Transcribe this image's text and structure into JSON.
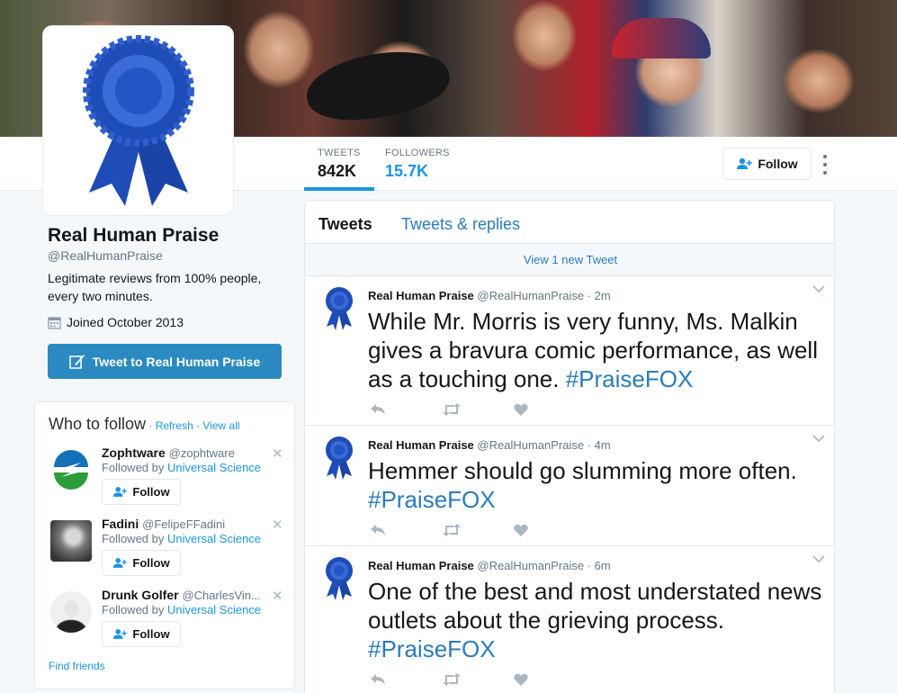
{
  "profile": {
    "name": "Real Human Praise",
    "handle": "@RealHumanPraise",
    "bio": "Legitimate reviews from 100% people, every two minutes.",
    "joined": "Joined October 2013",
    "tweet_to_label": "Tweet to Real Human Praise"
  },
  "nav": {
    "tweets_label": "TWEETS",
    "tweets_value": "842K",
    "followers_label": "FOLLOWERS",
    "followers_value": "15.7K",
    "follow_label": "Follow"
  },
  "who_to_follow": {
    "title": "Who to follow",
    "separator": " · ",
    "refresh": "Refresh",
    "view_all": "View all",
    "followed_by_prefix": "Followed by ",
    "follow_label": "Follow",
    "find_friends": "Find friends",
    "users": [
      {
        "name": "Zophtware",
        "handle": "@zophtware",
        "followed_by": "Universal Science"
      },
      {
        "name": "Fadini",
        "handle": "@FelipeFFadini",
        "followed_by": "Universal Science"
      },
      {
        "name": "Drunk Golfer",
        "handle": "@CharlesVin...",
        "followed_by": "Universal Science"
      }
    ]
  },
  "timeline": {
    "tab_tweets": "Tweets",
    "tab_replies": "Tweets & replies",
    "new_tweet_banner": "View 1 new Tweet",
    "tweets": [
      {
        "name": "Real Human Praise",
        "meta": "@RealHumanPraise · 2m",
        "text": "While Mr. Morris is very funny, Ms. Malkin gives a bravura comic performance, as well as a touching one. ",
        "hashtag": "#PraiseFOX"
      },
      {
        "name": "Real Human Praise",
        "meta": "@RealHumanPraise · 4m",
        "text": "Hemmer should go slumming more often. ",
        "hashtag": "#PraiseFOX"
      },
      {
        "name": "Real Human Praise",
        "meta": "@RealHumanPraise · 6m",
        "text": "One of the best and most understated news outlets about the grieving process. ",
        "hashtag": "#PraiseFOX"
      }
    ]
  },
  "colors": {
    "accent": "#1b95e0",
    "link": "#2b7bb9",
    "ribbon": "#1f4db8",
    "tweet_button": "#2b8ac1"
  }
}
